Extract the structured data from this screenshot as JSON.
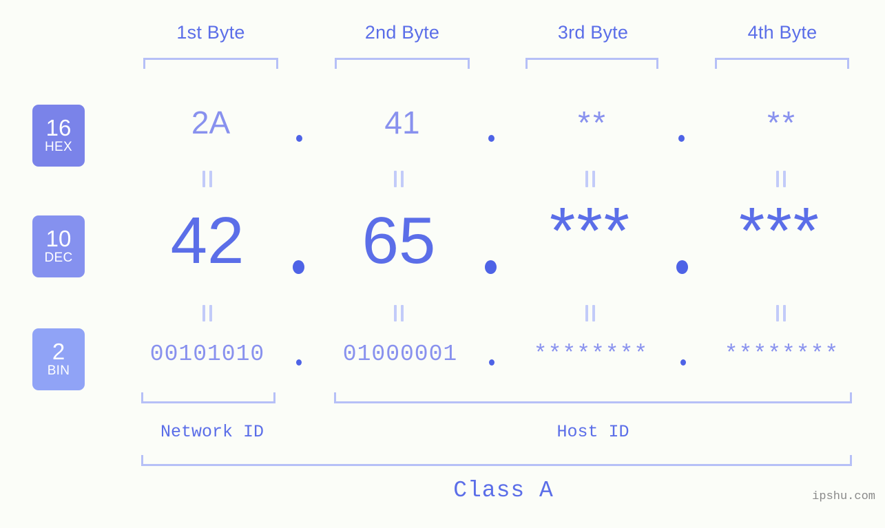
{
  "watermark": "ipshu.com",
  "colors": {
    "background": "#fbfdf8",
    "accent_strong": "#5b6ee8",
    "accent_light": "#8891ee",
    "bracket": "#b6c0f7",
    "dot": "#4e63e6",
    "equals": "#c2cbf9",
    "badge_hex": "#7a83e9",
    "badge_dec": "#8591ef",
    "badge_bin": "#90a3f6",
    "watermark": "#8a8a8a"
  },
  "byte_headers": [
    {
      "label": "1st Byte"
    },
    {
      "label": "2nd Byte"
    },
    {
      "label": "3rd Byte"
    },
    {
      "label": "4th Byte"
    }
  ],
  "rows": {
    "hex": {
      "radix": "16",
      "radix_name": "HEX",
      "values": [
        "2A",
        "41",
        "**",
        "**"
      ],
      "separator": "."
    },
    "dec": {
      "radix": "10",
      "radix_name": "DEC",
      "values": [
        "42",
        "65",
        "***",
        "***"
      ],
      "separator": "."
    },
    "bin": {
      "radix": "2",
      "radix_name": "BIN",
      "values": [
        "00101010",
        "01000001",
        "********",
        "********"
      ],
      "separator": "."
    }
  },
  "equals_marks": {
    "glyph": "=",
    "count_top_row": 4,
    "count_middle_row": 4
  },
  "sections": {
    "network_id": "Network ID",
    "host_id": "Host ID",
    "class": "Class A"
  }
}
